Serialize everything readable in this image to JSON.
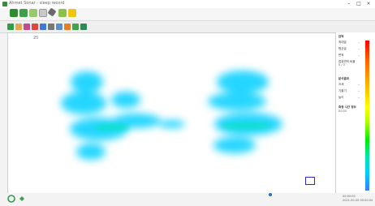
{
  "window": {
    "title": "Ahmet Sonar - sleep record"
  },
  "panel": {
    "sec1_title": "압력",
    "sec1_item1_label": "최대압",
    "sec1_item1_value": "--",
    "sec1_item2_label": "평균압",
    "sec1_item2_value": "--",
    "sec1_item3_label": "면적",
    "sec1_item3_value": "--",
    "sec1_item4_label": "접촉면적 비율",
    "sec1_item4_value": "0 / 0",
    "sec2_title": "분석결과",
    "sec2_item1_label": "자세",
    "sec2_item1_value": "--",
    "sec2_item2_label": "기울기",
    "sec2_item2_value": "--",
    "sec2_item3_label": "높이",
    "sec2_item3_value": "--",
    "sec3_title": "측정 시간 정보",
    "sec3_value": "00:00"
  },
  "canvas": {
    "frame_number": "25"
  },
  "status": {
    "line1": "00:00:00",
    "line2": "2021-00-00 00:00:00"
  },
  "colors": {
    "heat_primary": "#00cfff",
    "heat_core": "#00e6b0",
    "marker": "#2a2acc"
  }
}
